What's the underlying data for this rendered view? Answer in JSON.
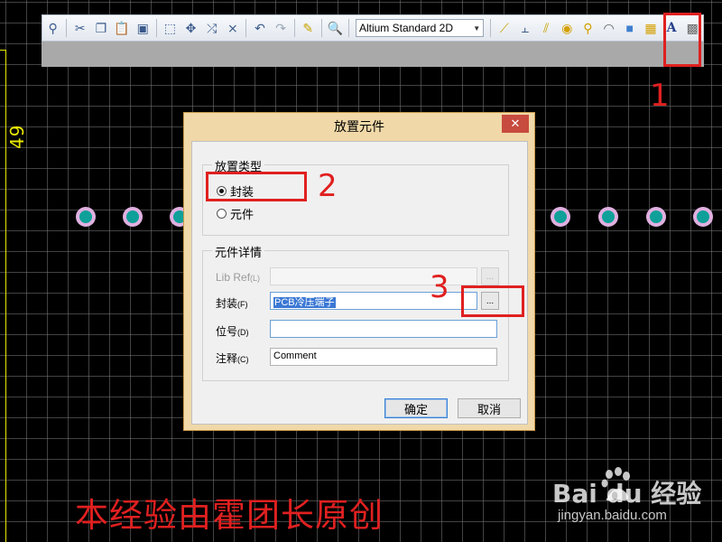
{
  "toolbar": {
    "icons": [
      "filter-icon",
      "cut-icon",
      "copy-icon",
      "paste-icon",
      "rubber-stamp-icon",
      "select-area-icon",
      "move-icon",
      "cross-select-icon",
      "clear-filter-icon",
      "undo-icon",
      "redo-icon",
      "interactive-route-icon",
      "zoom-icon",
      "route-icon",
      "multi-route-icon",
      "diff-pair-icon",
      "via-icon",
      "pad-icon",
      "arc-icon",
      "fill-icon",
      "polygon-icon",
      "string-icon",
      "component-icon"
    ],
    "view_select": "Altium Standard 2D"
  },
  "canvas": {
    "dimension_text": "49",
    "background": "#000000",
    "grid_color": "#787878",
    "pad_color": "#0fa09a",
    "pad_ring_color": "#e0b0e0"
  },
  "dialog": {
    "title": "放置元件",
    "close_label": "✕",
    "placement_type": {
      "label": "放置类型",
      "options": [
        {
          "label": "封装",
          "checked": true
        },
        {
          "label": "元件",
          "checked": false
        }
      ]
    },
    "details": {
      "label": "元件详情",
      "lib_ref_label": "Lib Ref",
      "lib_ref_key": "(L)",
      "lib_ref_value": "",
      "footprint_label": "封装",
      "footprint_key": "(F)",
      "footprint_value": "PCB冷压端子",
      "designator_label": "位号",
      "designator_key": "(D)",
      "designator_value": "",
      "comment_label": "注释",
      "comment_key": "(C)",
      "comment_value": "Comment"
    },
    "browse_label": "...",
    "ok_label": "确定",
    "cancel_label": "取消"
  },
  "annotations": {
    "num1": "1",
    "num2": "2",
    "num3": "3",
    "color": "#e02020"
  },
  "watermark": {
    "text": "本经验由霍团长原创",
    "logo": "Bai du 经验",
    "url": "jingyan.baidu.com"
  }
}
